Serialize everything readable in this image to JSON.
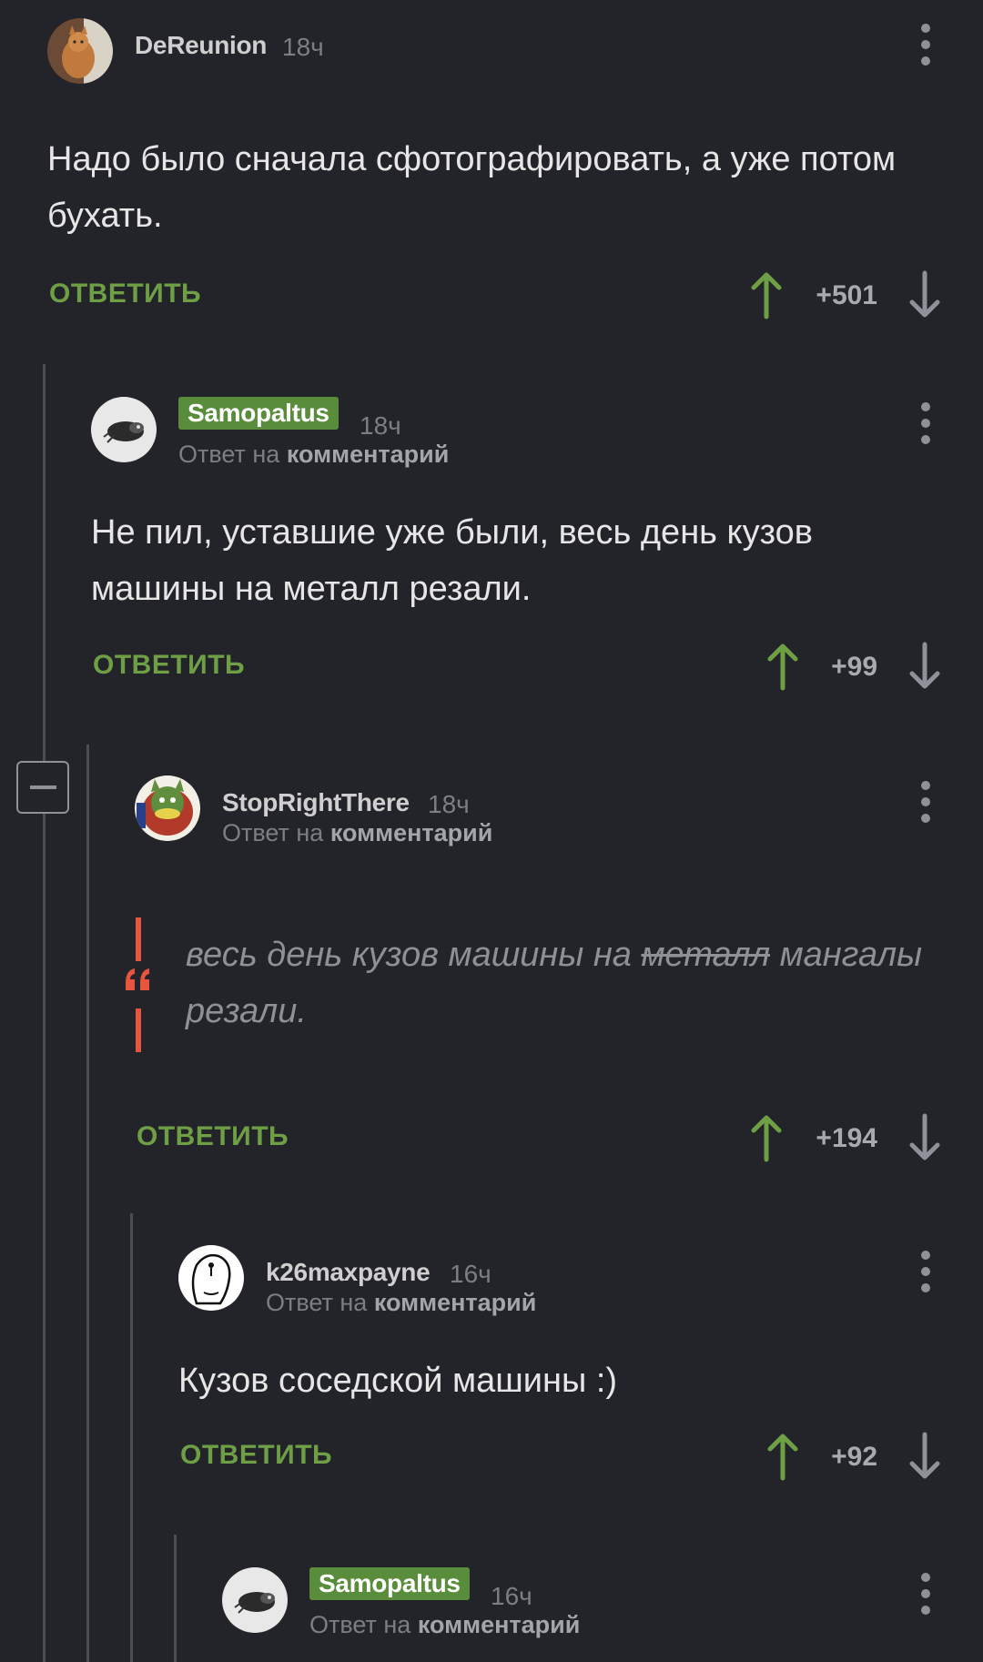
{
  "comments": [
    {
      "username": "DeReunion",
      "time": "18ч",
      "text": "Надо было сначала сфотографировать, а уже потом бухать.",
      "reply_label": "ОТВЕТИТЬ",
      "score": "+501"
    },
    {
      "username": "Samopaltus",
      "time": "18ч",
      "reply_prefix": "Ответ на",
      "reply_link": "комментарий",
      "text": "Не пил, уставшие уже были, весь день кузов машины на металл резали.",
      "reply_label": "ОТВЕТИТЬ",
      "score": "+99"
    },
    {
      "username": "StopRightThere",
      "time": "18ч",
      "reply_prefix": "Ответ на",
      "reply_link": "комментарий",
      "quote_before": "весь день кузов машины на",
      "quote_strike": "металл",
      "quote_after": "мангалы резали.",
      "reply_label": "ОТВЕТИТЬ",
      "score": "+194"
    },
    {
      "username": "k26maxpayne",
      "time": "16ч",
      "reply_prefix": "Ответ на",
      "reply_link": "комментарий",
      "text": "Кузов соседской машины :)",
      "reply_label": "ОТВЕТИТЬ",
      "score": "+92"
    },
    {
      "username": "Samopaltus",
      "time": "16ч",
      "reply_prefix": "Ответ на",
      "reply_link": "комментарий"
    }
  ],
  "colors": {
    "background": "#222429",
    "accent_green": "#6e9f45",
    "badge_green": "#5a8d3b",
    "quote_mark": "#e8553e"
  },
  "icons": [
    "more-vertical-icon",
    "arrow-up-icon",
    "arrow-down-icon",
    "collapse-minus-icon",
    "quote-icon"
  ]
}
